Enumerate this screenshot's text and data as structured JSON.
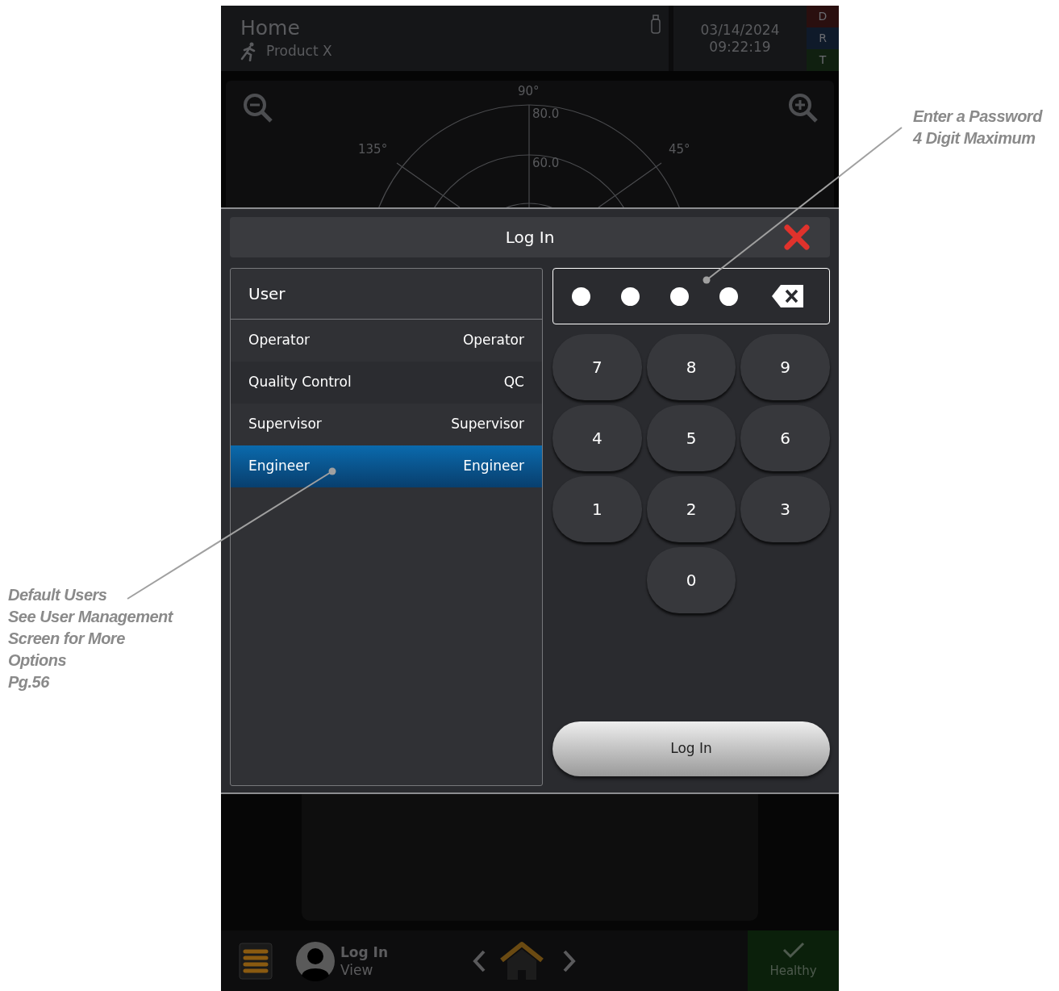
{
  "header": {
    "title": "Home",
    "product": "Product X",
    "date": "03/14/2024",
    "time": "09:22:19",
    "indicators": [
      {
        "letter": "D",
        "color": "#2a0f0f"
      },
      {
        "letter": "R",
        "color": "#0f1a2a"
      },
      {
        "letter": "T",
        "color": "#102010"
      }
    ]
  },
  "polar_labels": {
    "top": "90°",
    "upper_left": "135°",
    "upper_right": "45°",
    "rings": [
      "80.0",
      "60.0"
    ]
  },
  "dialog": {
    "title": "Log In",
    "user_header": "User",
    "users": [
      {
        "name": "Operator",
        "role": "Operator",
        "selected": false
      },
      {
        "name": "Quality Control",
        "role": "QC",
        "selected": false
      },
      {
        "name": "Supervisor",
        "role": "Supervisor",
        "selected": false
      },
      {
        "name": "Engineer",
        "role": "Engineer",
        "selected": true
      }
    ],
    "pin_dots": [
      {
        "filled": true
      },
      {
        "filled": true
      },
      {
        "filled": true
      },
      {
        "filled": true
      }
    ],
    "keys": [
      "7",
      "8",
      "9",
      "4",
      "5",
      "6",
      "1",
      "2",
      "3",
      "0"
    ],
    "login_button": "Log In"
  },
  "bottom_bar": {
    "user_label": "Log In",
    "user_sub": "View",
    "status": "Healthy"
  },
  "annotations": {
    "right": [
      "Enter a Password",
      "4 Digit Maximum"
    ],
    "left": [
      "Default Users",
      "See User Management",
      "Screen for More",
      "Options",
      "Pg.56"
    ]
  }
}
